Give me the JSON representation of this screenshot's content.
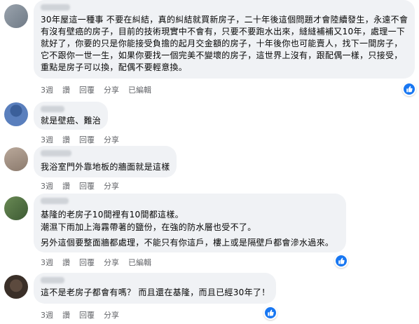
{
  "comments": [
    {
      "text": "30年屋這一種事 不要在糾結，真的糾結就買新房子，二十年後這個問題才會陸續發生，永遠不會有沒有壁癌的房子，目前的技術現實中不會有，只要不要跑水出來，縫縫補補又10年，處理一下就好了，你要的只是你能接受負擔的起月交金額的房子，十年後你也可能賣人，找下一間房子，它不跟你一世一生，如果你要找一個完美不變壞的房子，這世界上沒有，跟配偶一樣，只接受，重點是房子可以換，配偶不要輕意換。",
      "time": "3週",
      "like": "讚",
      "reply": "回覆",
      "share": "分享",
      "edited": "已編輯"
    },
    {
      "text": "就是壁癌、難治",
      "time": "3週",
      "like": "讚",
      "reply": "回覆",
      "share": "分享"
    },
    {
      "text": "我浴室門外靠地板的牆面就是這樣",
      "time": "3週",
      "like": "讚",
      "reply": "回覆",
      "share": "分享"
    },
    {
      "text_lines": [
        "基隆的老房子10間裡有10間都這樣。",
        "潮濕下雨加上海霧帶著的鹽份，在強的防水層也受不了。",
        "另外這個要整面牆都處理，不能只有你這戶，樓上或是隔壁戶都會滲水過來。"
      ],
      "time": "3週",
      "like": "讚",
      "reply": "回覆",
      "share": "分享",
      "edited": "已編輯"
    },
    {
      "text": "這不是老房子都會有嗎？ 而且還在基隆，而且已經30年了！",
      "time": "3週",
      "like": "讚",
      "reply": "回覆",
      "share": "分享"
    }
  ],
  "colors": {
    "bubble": "#f0f2f5",
    "like_badge": "#1877f2",
    "meta": "#65676b"
  },
  "icons": {
    "reaction": "thumbs-up-icon"
  }
}
